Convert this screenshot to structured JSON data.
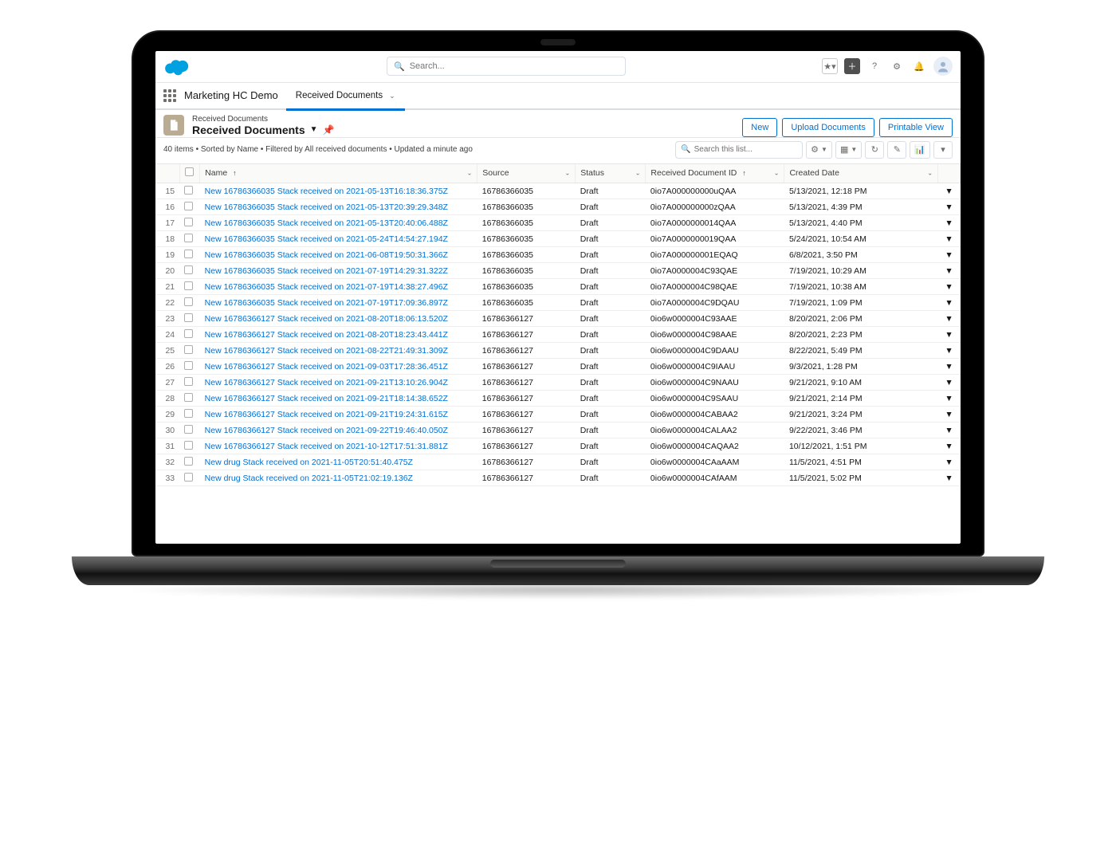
{
  "global_header": {
    "search_placeholder": "Search..."
  },
  "app": {
    "name": "Marketing HC Demo",
    "active_tab": "Received Documents"
  },
  "page_header": {
    "object_label": "Received Documents",
    "list_view_name": "Received Documents",
    "meta": "40 items • Sorted by Name • Filtered by All received documents • Updated a minute ago",
    "actions": {
      "new": "New",
      "upload": "Upload Documents",
      "printable": "Printable View"
    }
  },
  "list_controls": {
    "search_placeholder": "Search this list..."
  },
  "columns": {
    "name": "Name",
    "source": "Source",
    "status": "Status",
    "docid": "Received Document ID",
    "created": "Created Date"
  },
  "rows": [
    {
      "num": 15,
      "name": "New 16786366035 Stack received on 2021-05-13T16:18:36.375Z",
      "source": "16786366035",
      "status": "Draft",
      "docid": "0io7A000000000uQAA",
      "created": "5/13/2021, 12:18 PM"
    },
    {
      "num": 16,
      "name": "New 16786366035 Stack received on 2021-05-13T20:39:29.348Z",
      "source": "16786366035",
      "status": "Draft",
      "docid": "0io7A000000000zQAA",
      "created": "5/13/2021, 4:39 PM"
    },
    {
      "num": 17,
      "name": "New 16786366035 Stack received on 2021-05-13T20:40:06.488Z",
      "source": "16786366035",
      "status": "Draft",
      "docid": "0io7A0000000014QAA",
      "created": "5/13/2021, 4:40 PM"
    },
    {
      "num": 18,
      "name": "New 16786366035 Stack received on 2021-05-24T14:54:27.194Z",
      "source": "16786366035",
      "status": "Draft",
      "docid": "0io7A0000000019QAA",
      "created": "5/24/2021, 10:54 AM"
    },
    {
      "num": 19,
      "name": "New 16786366035 Stack received on 2021-06-08T19:50:31.366Z",
      "source": "16786366035",
      "status": "Draft",
      "docid": "0io7A000000001EQAQ",
      "created": "6/8/2021, 3:50 PM"
    },
    {
      "num": 20,
      "name": "New 16786366035 Stack received on 2021-07-19T14:29:31.322Z",
      "source": "16786366035",
      "status": "Draft",
      "docid": "0io7A0000004C93QAE",
      "created": "7/19/2021, 10:29 AM"
    },
    {
      "num": 21,
      "name": "New 16786366035 Stack received on 2021-07-19T14:38:27.496Z",
      "source": "16786366035",
      "status": "Draft",
      "docid": "0io7A0000004C98QAE",
      "created": "7/19/2021, 10:38 AM"
    },
    {
      "num": 22,
      "name": "New 16786366035 Stack received on 2021-07-19T17:09:36.897Z",
      "source": "16786366035",
      "status": "Draft",
      "docid": "0io7A0000004C9DQAU",
      "created": "7/19/2021, 1:09 PM"
    },
    {
      "num": 23,
      "name": "New 16786366127 Stack received on 2021-08-20T18:06:13.520Z",
      "source": "16786366127",
      "status": "Draft",
      "docid": "0io6w0000004C93AAE",
      "created": "8/20/2021, 2:06 PM"
    },
    {
      "num": 24,
      "name": "New 16786366127 Stack received on 2021-08-20T18:23:43.441Z",
      "source": "16786366127",
      "status": "Draft",
      "docid": "0io6w0000004C98AAE",
      "created": "8/20/2021, 2:23 PM"
    },
    {
      "num": 25,
      "name": "New 16786366127 Stack received on 2021-08-22T21:49:31.309Z",
      "source": "16786366127",
      "status": "Draft",
      "docid": "0io6w0000004C9DAAU",
      "created": "8/22/2021, 5:49 PM"
    },
    {
      "num": 26,
      "name": "New 16786366127 Stack received on 2021-09-03T17:28:36.451Z",
      "source": "16786366127",
      "status": "Draft",
      "docid": "0io6w0000004C9IAAU",
      "created": "9/3/2021, 1:28 PM"
    },
    {
      "num": 27,
      "name": "New 16786366127 Stack received on 2021-09-21T13:10:26.904Z",
      "source": "16786366127",
      "status": "Draft",
      "docid": "0io6w0000004C9NAAU",
      "created": "9/21/2021, 9:10 AM"
    },
    {
      "num": 28,
      "name": "New 16786366127 Stack received on 2021-09-21T18:14:38.652Z",
      "source": "16786366127",
      "status": "Draft",
      "docid": "0io6w0000004C9SAAU",
      "created": "9/21/2021, 2:14 PM"
    },
    {
      "num": 29,
      "name": "New 16786366127 Stack received on 2021-09-21T19:24:31.615Z",
      "source": "16786366127",
      "status": "Draft",
      "docid": "0io6w0000004CABAA2",
      "created": "9/21/2021, 3:24 PM"
    },
    {
      "num": 30,
      "name": "New 16786366127 Stack received on 2021-09-22T19:46:40.050Z",
      "source": "16786366127",
      "status": "Draft",
      "docid": "0io6w0000004CALAA2",
      "created": "9/22/2021, 3:46 PM"
    },
    {
      "num": 31,
      "name": "New 16786366127 Stack received on 2021-10-12T17:51:31.881Z",
      "source": "16786366127",
      "status": "Draft",
      "docid": "0io6w0000004CAQAA2",
      "created": "10/12/2021, 1:51 PM"
    },
    {
      "num": 32,
      "name": "New drug Stack received on 2021-11-05T20:51:40.475Z",
      "source": "16786366127",
      "status": "Draft",
      "docid": "0io6w0000004CAaAAM",
      "created": "11/5/2021, 4:51 PM"
    },
    {
      "num": 33,
      "name": "New drug Stack received on 2021-11-05T21:02:19.136Z",
      "source": "16786366127",
      "status": "Draft",
      "docid": "0io6w0000004CAfAAM",
      "created": "11/5/2021, 5:02 PM"
    }
  ]
}
